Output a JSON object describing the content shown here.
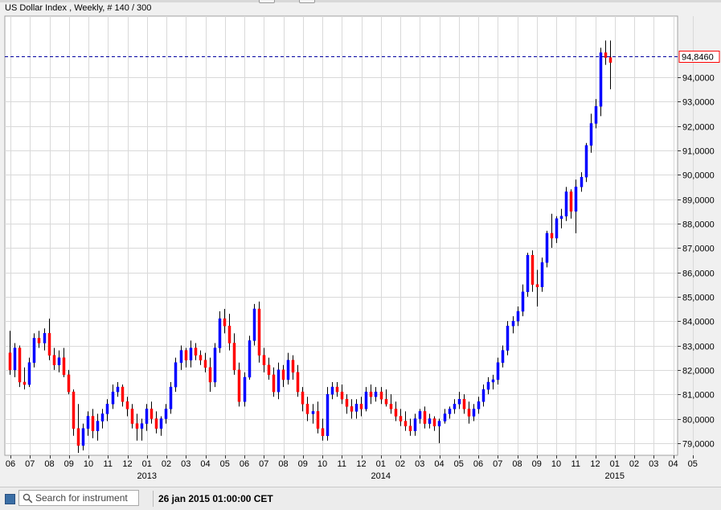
{
  "window": {
    "title": "US Dollar Index , Weekly, # 140 / 300"
  },
  "chart_data": {
    "type": "candlestick",
    "title": "US Dollar Index , Weekly, # 140 / 300",
    "ylim": [
      78.5,
      96.5
    ],
    "y_ticks": [
      "79,0000",
      "80,0000",
      "81,0000",
      "82,0000",
      "83,0000",
      "84,0000",
      "85,0000",
      "86,0000",
      "87,0000",
      "88,0000",
      "89,0000",
      "90,0000",
      "91,0000",
      "92,0000",
      "93,0000",
      "94,0000"
    ],
    "y_tick_values": [
      79,
      80,
      81,
      82,
      83,
      84,
      85,
      86,
      87,
      88,
      89,
      90,
      91,
      92,
      93,
      94
    ],
    "current_price": 94.846,
    "current_price_label": "94,8460",
    "x_month_labels": [
      "06",
      "07",
      "08",
      "09",
      "10",
      "11",
      "12",
      "01",
      "02",
      "03",
      "04",
      "05",
      "06",
      "07",
      "08",
      "09",
      "10",
      "11",
      "12",
      "01",
      "02",
      "03",
      "04",
      "05",
      "06",
      "07",
      "08",
      "09",
      "10",
      "11",
      "12",
      "01",
      "02",
      "03",
      "04",
      "05"
    ],
    "x_year_labels": [
      "2013",
      "2014",
      "2015"
    ],
    "grid": true,
    "up_color": "#0000ff",
    "down_color": "#ff0000",
    "candles": [
      [
        82.7,
        83.6,
        81.8,
        82.0
      ],
      [
        82.0,
        83.1,
        81.7,
        82.9
      ],
      [
        82.9,
        83.0,
        81.3,
        81.5
      ],
      [
        81.5,
        82.1,
        81.2,
        81.4
      ],
      [
        81.4,
        82.5,
        81.3,
        82.3
      ],
      [
        82.3,
        83.5,
        82.1,
        83.3
      ],
      [
        83.3,
        83.6,
        82.9,
        83.1
      ],
      [
        83.1,
        83.7,
        82.8,
        83.5
      ],
      [
        83.5,
        84.1,
        82.4,
        82.6
      ],
      [
        82.6,
        82.9,
        82.0,
        82.2
      ],
      [
        82.2,
        82.8,
        81.9,
        82.5
      ],
      [
        82.5,
        82.9,
        81.7,
        81.8
      ],
      [
        81.8,
        82.0,
        81.0,
        81.1
      ],
      [
        81.1,
        81.2,
        79.3,
        79.6
      ],
      [
        79.6,
        80.6,
        78.6,
        78.9
      ],
      [
        78.9,
        79.8,
        78.7,
        79.6
      ],
      [
        79.6,
        80.3,
        79.3,
        80.1
      ],
      [
        80.1,
        80.4,
        79.2,
        79.5
      ],
      [
        79.5,
        80.2,
        79.1,
        79.9
      ],
      [
        79.9,
        80.4,
        79.6,
        80.2
      ],
      [
        80.2,
        80.8,
        79.9,
        80.6
      ],
      [
        80.6,
        81.4,
        80.4,
        81.1
      ],
      [
        81.1,
        81.5,
        80.9,
        81.3
      ],
      [
        81.3,
        81.4,
        80.5,
        80.7
      ],
      [
        80.7,
        80.9,
        80.1,
        80.4
      ],
      [
        80.4,
        80.6,
        79.6,
        79.8
      ],
      [
        79.8,
        80.2,
        79.1,
        79.6
      ],
      [
        79.6,
        80.0,
        79.1,
        79.8
      ],
      [
        79.8,
        80.6,
        79.5,
        80.4
      ],
      [
        80.4,
        80.7,
        79.8,
        80.0
      ],
      [
        80.0,
        80.3,
        79.4,
        79.6
      ],
      [
        79.6,
        80.1,
        79.3,
        80.0
      ],
      [
        80.0,
        80.6,
        79.8,
        80.4
      ],
      [
        80.4,
        81.5,
        80.2,
        81.3
      ],
      [
        81.3,
        82.5,
        81.1,
        82.3
      ],
      [
        82.3,
        83.0,
        82.0,
        82.8
      ],
      [
        82.8,
        82.9,
        82.1,
        82.4
      ],
      [
        82.4,
        83.2,
        82.1,
        82.9
      ],
      [
        82.9,
        83.1,
        82.4,
        82.6
      ],
      [
        82.6,
        82.8,
        82.2,
        82.4
      ],
      [
        82.4,
        82.7,
        81.9,
        82.1
      ],
      [
        82.1,
        82.5,
        81.1,
        81.5
      ],
      [
        81.5,
        83.1,
        81.3,
        82.9
      ],
      [
        82.9,
        84.4,
        82.7,
        84.1
      ],
      [
        84.1,
        84.5,
        83.5,
        83.8
      ],
      [
        83.8,
        84.3,
        82.8,
        83.1
      ],
      [
        83.1,
        83.5,
        81.8,
        82.0
      ],
      [
        82.0,
        82.3,
        80.5,
        80.7
      ],
      [
        80.7,
        81.9,
        80.5,
        81.7
      ],
      [
        81.7,
        83.4,
        81.6,
        83.2
      ],
      [
        83.2,
        84.7,
        83.0,
        84.5
      ],
      [
        84.5,
        84.8,
        82.3,
        82.6
      ],
      [
        82.6,
        82.9,
        81.9,
        82.2
      ],
      [
        82.2,
        82.5,
        81.6,
        81.8
      ],
      [
        81.8,
        82.1,
        80.9,
        81.1
      ],
      [
        81.1,
        82.3,
        80.8,
        82.0
      ],
      [
        82.0,
        82.2,
        81.3,
        81.6
      ],
      [
        81.6,
        82.7,
        81.4,
        82.4
      ],
      [
        82.4,
        82.6,
        81.6,
        81.9
      ],
      [
        81.9,
        82.2,
        80.9,
        81.1
      ],
      [
        81.1,
        81.3,
        80.3,
        80.6
      ],
      [
        80.6,
        80.9,
        79.9,
        80.2
      ],
      [
        80.2,
        80.6,
        79.8,
        80.3
      ],
      [
        80.3,
        80.7,
        79.4,
        79.6
      ],
      [
        79.6,
        80.0,
        79.1,
        79.3
      ],
      [
        79.3,
        81.3,
        79.1,
        81.0
      ],
      [
        81.0,
        81.5,
        80.8,
        81.3
      ],
      [
        81.3,
        81.5,
        80.9,
        81.1
      ],
      [
        81.1,
        81.4,
        80.6,
        80.8
      ],
      [
        80.8,
        81.0,
        80.2,
        80.5
      ],
      [
        80.5,
        80.8,
        80.0,
        80.3
      ],
      [
        80.3,
        80.8,
        80.0,
        80.6
      ],
      [
        80.6,
        80.9,
        80.1,
        80.4
      ],
      [
        80.4,
        81.3,
        80.3,
        81.1
      ],
      [
        81.1,
        81.4,
        80.6,
        80.9
      ],
      [
        80.9,
        81.3,
        80.7,
        81.1
      ],
      [
        81.1,
        81.3,
        80.6,
        80.8
      ],
      [
        80.8,
        81.2,
        80.5,
        80.6
      ],
      [
        80.6,
        81.0,
        80.2,
        80.4
      ],
      [
        80.4,
        80.7,
        79.9,
        80.1
      ],
      [
        80.1,
        80.4,
        79.7,
        79.9
      ],
      [
        79.9,
        80.3,
        79.5,
        79.7
      ],
      [
        79.7,
        80.0,
        79.3,
        79.5
      ],
      [
        79.5,
        80.2,
        79.3,
        80.0
      ],
      [
        80.0,
        80.4,
        79.8,
        80.3
      ],
      [
        80.3,
        80.5,
        79.6,
        79.8
      ],
      [
        79.8,
        80.2,
        79.6,
        80.0
      ],
      [
        80.0,
        80.1,
        79.5,
        79.7
      ],
      [
        79.7,
        80.0,
        79.0,
        79.9
      ],
      [
        79.9,
        80.4,
        79.8,
        80.2
      ],
      [
        80.2,
        80.5,
        80.0,
        80.4
      ],
      [
        80.4,
        80.8,
        80.2,
        80.6
      ],
      [
        80.6,
        81.1,
        80.4,
        80.8
      ],
      [
        80.8,
        81.0,
        80.2,
        80.4
      ],
      [
        80.4,
        80.7,
        79.8,
        80.1
      ],
      [
        80.1,
        80.6,
        79.9,
        80.4
      ],
      [
        80.4,
        80.9,
        80.2,
        80.7
      ],
      [
        80.7,
        81.4,
        80.5,
        81.2
      ],
      [
        81.2,
        81.7,
        81.0,
        81.5
      ],
      [
        81.5,
        81.8,
        81.2,
        81.6
      ],
      [
        81.6,
        82.5,
        81.4,
        82.3
      ],
      [
        82.3,
        83.0,
        82.1,
        82.8
      ],
      [
        82.8,
        84.0,
        82.6,
        83.8
      ],
      [
        83.8,
        84.2,
        83.5,
        84.0
      ],
      [
        84.0,
        84.6,
        83.8,
        84.4
      ],
      [
        84.4,
        85.5,
        84.2,
        85.2
      ],
      [
        85.2,
        86.8,
        85.0,
        86.7
      ],
      [
        86.7,
        86.9,
        85.2,
        85.5
      ],
      [
        85.5,
        86.1,
        84.6,
        85.4
      ],
      [
        85.4,
        86.6,
        85.2,
        86.4
      ],
      [
        86.4,
        87.7,
        86.2,
        87.6
      ],
      [
        87.6,
        88.4,
        87.0,
        87.4
      ],
      [
        87.4,
        88.3,
        87.2,
        88.2
      ],
      [
        88.2,
        88.6,
        87.8,
        88.3
      ],
      [
        88.3,
        89.5,
        88.1,
        89.3
      ],
      [
        89.3,
        89.4,
        88.2,
        88.5
      ],
      [
        88.5,
        89.8,
        87.6,
        89.5
      ],
      [
        89.5,
        90.1,
        89.3,
        89.9
      ],
      [
        89.9,
        91.3,
        89.7,
        91.2
      ],
      [
        91.2,
        92.5,
        90.9,
        92.1
      ],
      [
        92.1,
        93.1,
        91.9,
        92.8
      ],
      [
        92.8,
        95.2,
        92.4,
        95.0
      ],
      [
        95.0,
        95.5,
        94.5,
        94.8
      ],
      [
        94.8,
        95.5,
        93.5,
        94.6
      ]
    ]
  },
  "statusbar": {
    "search_placeholder": "Search for instrument",
    "datetime": "26 jan 2015 01:00:00 CET"
  },
  "colors": {
    "grid": "#d9d9d9",
    "background": "#ffffff",
    "price_line": "#0000a0",
    "price_label_border": "#ff0000"
  }
}
